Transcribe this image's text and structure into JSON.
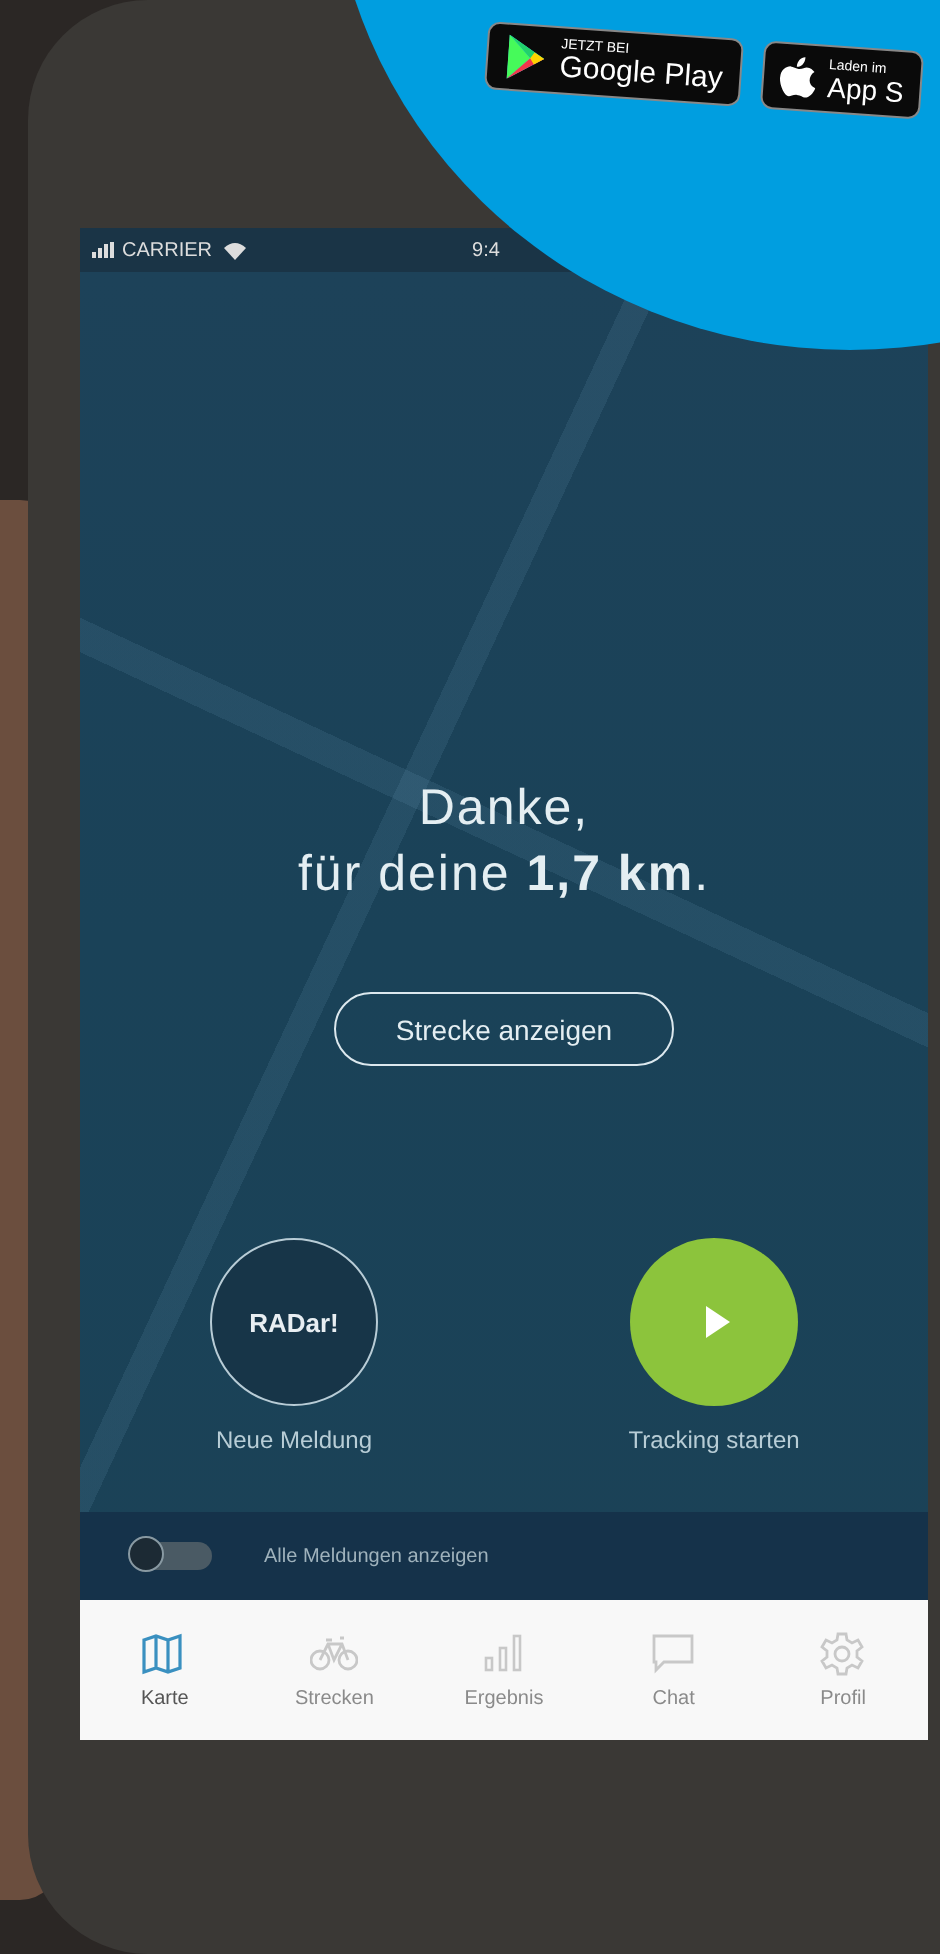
{
  "badges": [
    {
      "kind": "google",
      "small": "JETZT BEI",
      "big": "Google Play"
    },
    {
      "kind": "apple",
      "small": "Laden im",
      "big": "App S"
    }
  ],
  "status_bar": {
    "carrier": "CARRIER",
    "time": "9:4"
  },
  "message": {
    "line_1": "Danke,",
    "line_2": "für deine **1,7 km**."
  },
  "route_button": "Strecke anzeigen",
  "actions": [
    {
      "kind": "report",
      "button": "RADar!",
      "label": "Neue Meldung"
    },
    {
      "kind": "tracking",
      "label": "Tracking starten"
    }
  ],
  "toggle": {
    "on": false,
    "label": "Alle Meldungen anzeigen"
  },
  "tabs": [
    {
      "kind": "map",
      "label": "Karte",
      "selected": true
    },
    {
      "kind": "bike",
      "label": "Strecken",
      "selected": false
    },
    {
      "kind": "chart",
      "label": "Ergebnis",
      "selected": false
    },
    {
      "kind": "chat",
      "label": "Chat",
      "selected": false
    },
    {
      "kind": "gear",
      "label": "Profil",
      "selected": false
    }
  ]
}
